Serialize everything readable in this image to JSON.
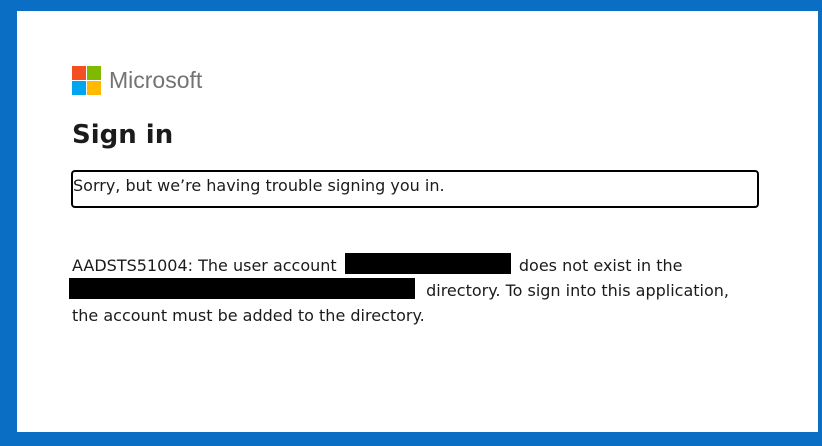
{
  "brand": {
    "name": "Microsoft",
    "logo_colors": [
      "#f25022",
      "#7fba00",
      "#00a4ef",
      "#ffb900"
    ],
    "frame_color": "#0a6fc4"
  },
  "page": {
    "title": "Sign in"
  },
  "error": {
    "message": "Sorry, but we’re having trouble signing you in."
  },
  "details": {
    "part1": "AADSTS51004: The user account",
    "part2": "does not exist in the",
    "part3": "directory. To sign into this application,",
    "part4": "the account must be added to the directory.",
    "redactions": [
      "redacted-user-account",
      "redacted-directory-name"
    ]
  }
}
